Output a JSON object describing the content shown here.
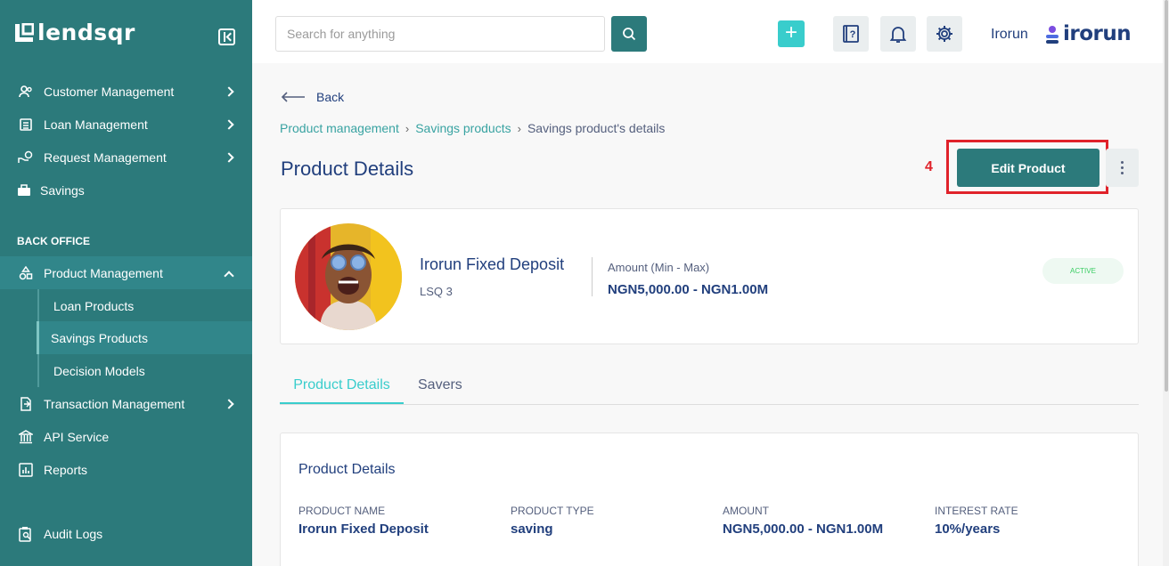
{
  "app": {
    "brand": "lendsqr"
  },
  "sidebar": {
    "items": [
      {
        "label": "Customer Management"
      },
      {
        "label": "Loan Management"
      },
      {
        "label": "Request Management"
      },
      {
        "label": "Savings"
      }
    ],
    "section_title": "BACK OFFICE",
    "product_management": {
      "label": "Product Management",
      "children": [
        {
          "label": "Loan Products"
        },
        {
          "label": "Savings Products"
        },
        {
          "label": "Decision Models"
        }
      ]
    },
    "items_after": [
      {
        "label": "Transaction Management"
      },
      {
        "label": "API Service"
      },
      {
        "label": "Reports"
      }
    ],
    "audit_logs": {
      "label": "Audit Logs"
    }
  },
  "header": {
    "search_placeholder": "Search for anything",
    "user_name": "Irorun",
    "org_brand": "irorun",
    "icons": [
      "search-icon",
      "plus-icon",
      "help-book-icon",
      "bell-icon",
      "gear-icon"
    ]
  },
  "main": {
    "back_label": "Back",
    "breadcrumb": [
      "Product management",
      "Savings products",
      "Savings product's details"
    ],
    "page_title": "Product Details",
    "step_marker": "4",
    "edit_button": "Edit Product",
    "product": {
      "name": "Irorun Fixed Deposit",
      "code": "LSQ 3",
      "amount_label": "Amount (Min - Max)",
      "amount_value": "NGN5,000.00 - NGN1.00M",
      "status": "ACTIVE"
    },
    "tabs": [
      {
        "label": "Product Details",
        "active": true
      },
      {
        "label": "Savers",
        "active": false
      }
    ],
    "details": {
      "title": "Product Details",
      "fields": [
        {
          "label": "PRODUCT NAME",
          "value": "Irorun Fixed Deposit"
        },
        {
          "label": "PRODUCT TYPE",
          "value": "saving"
        },
        {
          "label": "AMOUNT",
          "value": "NGN5,000.00 - NGN1.00M"
        },
        {
          "label": "INTEREST RATE",
          "value": "10%/years"
        }
      ]
    }
  },
  "colors": {
    "sidebar": "#2c7a7b",
    "accent": "#39cdcc",
    "primary_text": "#213f7d",
    "status_green": "#39cd62",
    "highlight_red": "#e0222a"
  }
}
